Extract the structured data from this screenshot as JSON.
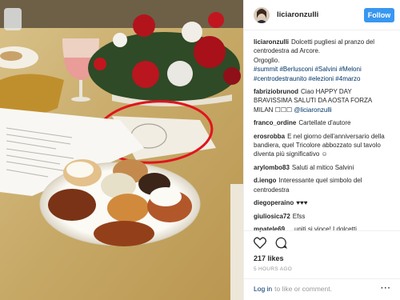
{
  "header": {
    "username": "liciaronzulli",
    "follow_label": "Follow"
  },
  "caption": {
    "username": "liciaronzulli",
    "line1": "Dolcetti pugliesi al pranzo del centrodestra ad Arcore.",
    "line2": "Orgoglio.",
    "hashtags": "#summit #Berlusconi #Salvini #Meloni #centrodestraunito #elezioni #4marzo"
  },
  "comments": [
    {
      "user": "fabriziobrunod",
      "text": "Ciao HAPPY DAY BRAVISSIMA SALUTI DA AOSTA FORZA MILAN ☐☐☐",
      "mention": "@liciaronzulli"
    },
    {
      "user": "franco_ordine",
      "text": "Cartellate d'autore",
      "mention": ""
    },
    {
      "user": "erosrobba",
      "text": "E nel giorno dell'anniversario della bandiera, quel Tricolore abbozzato sul tavolo diventa più significativo ☺",
      "mention": ""
    },
    {
      "user": "arylombo83",
      "text": "Saluti al mitico Salvini",
      "mention": ""
    },
    {
      "user": "d.iengo",
      "text": "Interessante quel simbolo del centrodestra",
      "mention": ""
    },
    {
      "user": "diegoperaino",
      "text": "♥♥♥",
      "mention": ""
    },
    {
      "user": "giuliosica72",
      "text": "Efss",
      "mention": ""
    },
    {
      "user": "mpatele69",
      "text": "... uniti si vince! I dolcetti",
      "mention": ""
    }
  ],
  "actions": {
    "like_icon": "heart-icon",
    "comment_icon": "speech-bubble-icon",
    "likes_text": "217 likes",
    "time_text": "5 HOURS AGO"
  },
  "footer": {
    "login_link": "Log in",
    "login_text": "to like or comment.",
    "more_label": "···"
  },
  "colors": {
    "follow_button": "#3897f0",
    "link": "#003569",
    "annotation_circle": "#e0141e"
  }
}
